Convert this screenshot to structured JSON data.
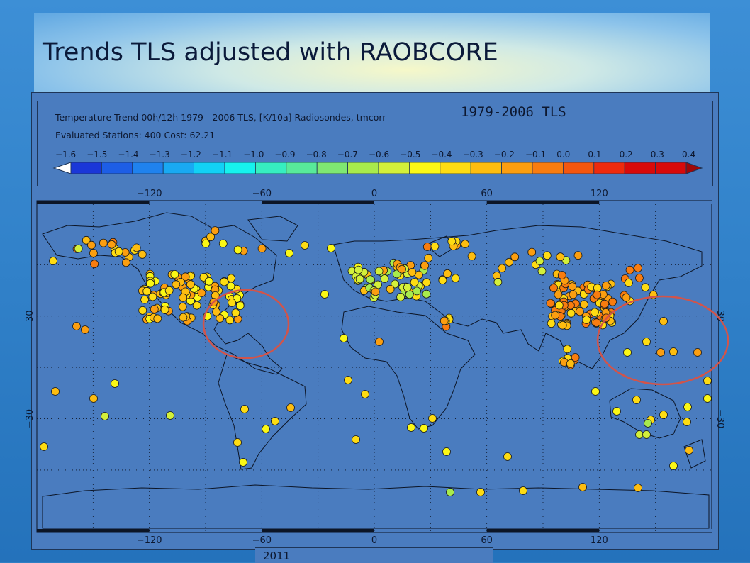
{
  "slide": {
    "title": "Trends TLS adjusted with RAOBCORE",
    "footer": "2011"
  },
  "legend": {
    "line1": "Temperature Trend 00h/12h 1979—2006 TLS, [K/10a] Radiosondes, tmcorr",
    "line2": "Evaluated Stations: 400 Cost:  62.21",
    "period_label": "1979-2006 TLS",
    "scale": [
      {
        "label": "−1.6",
        "color": "#ffffff"
      },
      {
        "label": "−1.5",
        "color": "#1a37d8"
      },
      {
        "label": "−1.4",
        "color": "#1d5ee6"
      },
      {
        "label": "−1.3",
        "color": "#1f82ee"
      },
      {
        "label": "−1.2",
        "color": "#19a9f2"
      },
      {
        "label": "−1.1",
        "color": "#12d1f5"
      },
      {
        "label": "−1.0",
        "color": "#16f2ee"
      },
      {
        "label": "−0.9",
        "color": "#36eec0"
      },
      {
        "label": "−0.8",
        "color": "#58ea9a"
      },
      {
        "label": "−0.7",
        "color": "#7fe872"
      },
      {
        "label": "−0.6",
        "color": "#a8eb4c"
      },
      {
        "label": "−0.5",
        "color": "#d3f03a"
      },
      {
        "label": "−0.4",
        "color": "#fbf815"
      },
      {
        "label": "−0.3",
        "color": "#fedc12"
      },
      {
        "label": "−0.2",
        "color": "#fdbd10"
      },
      {
        "label": "−0.1",
        "color": "#fb9e10"
      },
      {
        "label": "0.0",
        "color": "#f87c0f"
      },
      {
        "label": "0.1",
        "color": "#f4560e"
      },
      {
        "label": "0.2",
        "color": "#ee2a0d"
      },
      {
        "label": "0.3",
        "color": "#d80a0a"
      },
      {
        "label": "0.4",
        "color": "#a00808"
      }
    ]
  },
  "map": {
    "top_axis_labels": [
      "−120",
      "−60",
      "0",
      "60",
      "120"
    ],
    "bottom_axis_labels": [
      "−120",
      "−60",
      "0",
      "60",
      "120"
    ],
    "left_axis_labels": [
      "30",
      "−30"
    ],
    "right_axis_labels": [
      "30",
      "−30"
    ],
    "ocean_color": "#4a7cbf",
    "highlight_color": "#d2544a"
  }
}
